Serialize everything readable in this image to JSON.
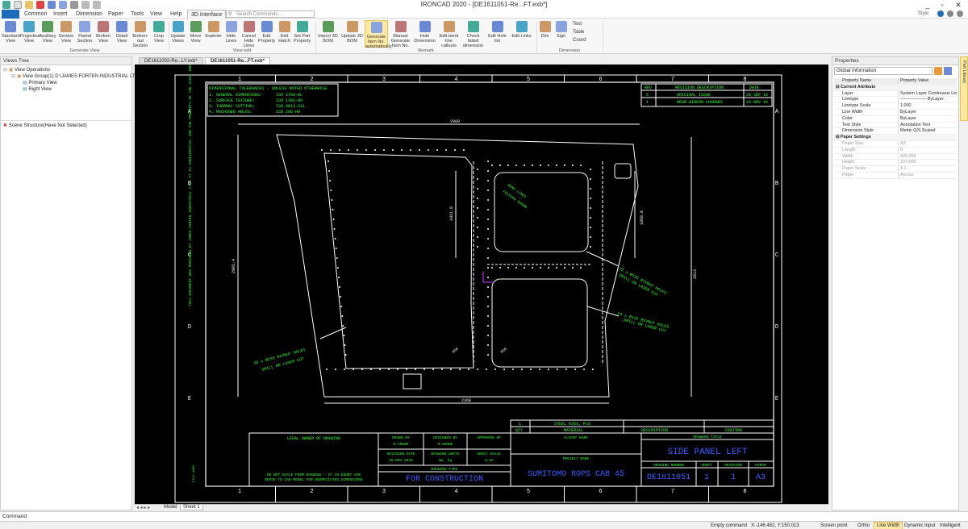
{
  "app": {
    "title": "IRONCAD 2020 - [DE1611051-Re...FT.exb*]",
    "style_label": "Style",
    "window_controls": [
      "_",
      "▫",
      "✕"
    ]
  },
  "menu": {
    "tabs": [
      "Common",
      "Insert",
      "Dimension",
      "Paper",
      "Tools",
      "View",
      "Help",
      "3D Interface"
    ],
    "active_tab": "3D Interface",
    "search_placeholder": "Search Commands..."
  },
  "ribbon": {
    "groups": [
      {
        "label": "Generate View",
        "buttons": [
          "Standard View",
          "Projection View",
          "Auxiliary View",
          "Section View",
          "Partial Section",
          "Broken View",
          "Detail View",
          "Broken-out Section",
          "Crop View"
        ]
      },
      {
        "label": "View edit",
        "buttons": [
          "Update Views",
          "Move View",
          "Explode",
          "Hide Lines",
          "Cancel Hide Lines",
          "Edit Property",
          "Edit Hatch",
          "Set Part Property"
        ]
      },
      {
        "label": "Remark",
        "buttons": [
          "Import 3D BOM",
          "Update 3D BOM",
          "Generate Item No. automatically",
          "Manual Generate Item No.",
          "Hole Dimension",
          "Edit bend line callouts",
          "Check failed dimension",
          "Edit Hole list",
          "Edit Links"
        ]
      },
      {
        "label": "Dimension",
        "buttons": [
          "Dim",
          "Sign"
        ],
        "small": [
          "Text",
          "Table",
          "Coord"
        ]
      }
    ]
  },
  "views_tree": {
    "title": "Views Tree",
    "items": [
      "View Operations",
      "View Group(1)  D:\\JAMES FORTEN INDUSTRIAL LTD\\D",
      "Primary View",
      "Right View",
      "Scene Structure(Have Not Selected)"
    ]
  },
  "doc_tabs": [
    "DE1611002-Re...LY.exb*",
    "DE1611051-Re...FT.exb*"
  ],
  "sheet_tabs": [
    "Model",
    "Sheet 1"
  ],
  "properties": {
    "title": "Properties",
    "selector": "Global Information",
    "col_name": "Property Name",
    "col_value": "Property Value",
    "sections": [
      {
        "name": "Current Attribute",
        "rows": [
          [
            "Layer",
            "System Layer Continuous Lines..."
          ],
          [
            "Linetype",
            "—————— ByLayer"
          ],
          [
            "Linetype Scale",
            "1.000"
          ],
          [
            "Line Width",
            "ByLayer"
          ],
          [
            "Color",
            "ByLayer"
          ],
          [
            "Text Style",
            "Annotation Text"
          ],
          [
            "Dimension Style",
            "Metric Q/S Scaled"
          ]
        ]
      },
      {
        "name": "Paper Settings",
        "rows": [
          [
            "Paper Size",
            "A3"
          ],
          [
            "Length",
            "0"
          ],
          [
            "Width",
            "420.000"
          ],
          [
            "Height",
            "297.000"
          ],
          [
            "Paper Scale",
            "1:1"
          ],
          [
            "Paper",
            "Across"
          ]
        ]
      }
    ],
    "side_tab": "Part Library"
  },
  "drawing": {
    "col_zones": [
      "1",
      "2",
      "3",
      "4",
      "5",
      "6",
      "7",
      "8"
    ],
    "row_zones": [
      "A",
      "B",
      "C",
      "D",
      "E"
    ],
    "tolerances_title": "DIMENSIONAL TOLERANCES - UNLESS NOTED OTHERWISE",
    "tolerances": [
      [
        "1. GENERAL DIMENSIONS:",
        "ISO 2768-mL"
      ],
      [
        "2. SURFACE TEXTURE:",
        "ISO 1302-N8"
      ],
      [
        "3. THERMAL CUTTING:",
        "ISO 9013-331"
      ],
      [
        "4. MACHINED HOLES:",
        "ISO 286-H9"
      ]
    ],
    "revision_headers": [
      "REV",
      "REVISION DESCRIPTION",
      "DATE"
    ],
    "revisions": [
      [
        "X",
        "ORIGINAL ISSUE",
        "28 SEP 16"
      ],
      [
        "1",
        "REAR WINDOW CHANGES",
        "16 NOV 16"
      ]
    ],
    "dims": {
      "top": "2960",
      "bottom": "2368",
      "left": "2965.4",
      "right": "2813",
      "inner_left": "1021.9",
      "inner_right": "1059.6",
      "r_top": "R50",
      "r_bot": "R50"
    },
    "notes": [
      "38 x Ø135 RIVNUT HOLES",
      "DRILL OR LASER CUT",
      "22 x Ø135 RIVNUT HOLES",
      "DRILL OR LASER CUT",
      "23 x Ø135 RIVNUT HOLES",
      "DRILL OR LASER CUT",
      "BEND LINES",
      "FOLDING SHOWN"
    ],
    "side_text": "THIS DOCUMENT WAS PREPARED BY JAMES FORTEN INDUSTRIAL LTD. IT IS CONFIDENTIAL AND THE PROPERTY OF THE LEGAL OWNER",
    "bom": {
      "row": [
        "1",
        "STEEL G35X, PL6"
      ],
      "headers": [
        "QTY",
        "MATERIAL",
        "DESCRIPTION",
        "COATING"
      ]
    },
    "title_block": {
      "legal_owner": "LEGAL OWNER OF DRAWING",
      "drawn_by_label": "DRAWN BY",
      "drawn_by": "M.CROWE",
      "designed_by_label": "DESIGNED BY",
      "designed_by": "M.CROWE",
      "approved_by_label": "APPROVED BY",
      "revision_date_label": "REVISION DATE",
      "revision_date": "16 NOV 2016",
      "drawing_units_label": "DRAWING UNITS",
      "drawing_units": "mm, kg",
      "sheet_scale_label": "SHEET SCALE",
      "sheet_scale": "1:12",
      "drawing_type_label": "DRAWING TYPE",
      "drawing_type": "FOR CONSTRUCTION",
      "client_name_label": "CLIENT NAME",
      "project_name_label": "PROJECT NAME",
      "project_name": "SUMITOMO ROPS CAB 45",
      "drawing_title_label": "DRAWING TITLE",
      "drawing_title": "SIDE PANEL LEFT",
      "drawing_number_label": "DRAWING NUMBER",
      "drawing_number": "DE1611051",
      "sheet_label": "SHEET",
      "sheet": "1",
      "revision_label": "REVISION",
      "revision": "1",
      "paper_label": "PAPER",
      "paper": "A3",
      "disclaimer1": "DO NOT SCALE FROM DRAWING - IF IN DOUBT ASK",
      "disclaimer2": "REFER TO CAD MODEL FOR UNSPECIFIED DIMENSIONS",
      "file_name": "FILE NAME"
    }
  },
  "command": {
    "label": "Command:"
  },
  "status": {
    "mode": "Empty command",
    "coords": "X:-146.482, Y:150.013",
    "items": [
      "Screen point",
      "Ortho",
      "Line Width",
      "Dynamic Input",
      "Intelligent"
    ],
    "active": "Line Width"
  },
  "colors": {
    "accent": "#1e6bb8",
    "draw_bg": "#000000",
    "draw_line": "#ffffff",
    "draw_text": "#33ff33",
    "draw_blue": "#3f5fff",
    "highlight": "#fce9a6"
  }
}
